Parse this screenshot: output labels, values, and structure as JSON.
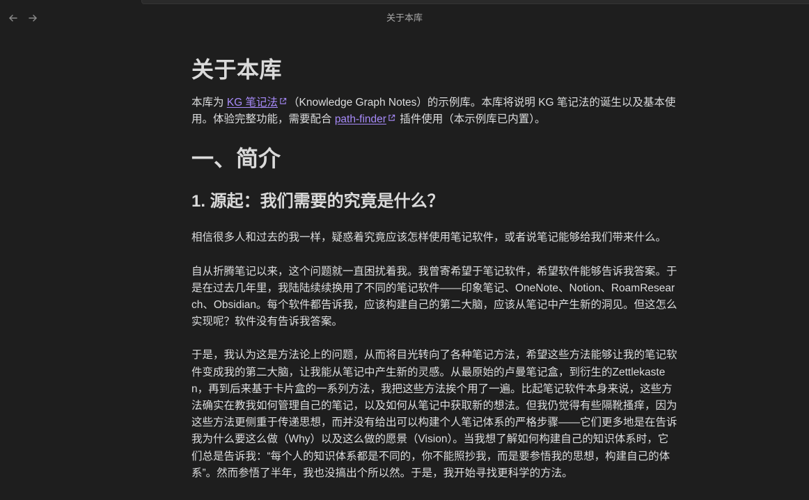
{
  "topbar": {
    "title": "关于本库",
    "back_icon": "arrow-left-icon",
    "forward_icon": "arrow-right-icon"
  },
  "document": {
    "title": "关于本库",
    "intro": {
      "before_link1": "本库为 ",
      "link1_text": "KG 笔记法",
      "between": "（Knowledge Graph Notes）的示例库。本库将说明 KG 笔记法的诞生以及基本使用。体验完整功能，需要配合 ",
      "link2_text": "path-finder",
      "after_link2": " 插件使用（本示例库已内置）。"
    },
    "h2_intro": "一、简介",
    "h3_origin": "1. 源起：我们需要的究竟是什么？",
    "para1": "相信很多人和过去的我一样，疑惑着究竟应该怎样使用笔记软件，或者说笔记能够给我们带来什么。",
    "para2": "自从折腾笔记以来，这个问题就一直困扰着我。我曾寄希望于笔记软件，希望软件能够告诉我答案。于是在过去几年里，我陆陆续续换用了不同的笔记软件——印象笔记、OneNote、Notion、RoamResearch、Obsidian。每个软件都告诉我，应该构建自己的第二大脑，应该从笔记中产生新的洞见。但这怎么实现呢？软件没有告诉我答案。",
    "para3": "于是，我认为这是方法论上的问题，从而将目光转向了各种笔记方法，希望这些方法能够让我的笔记软件变成我的第二大脑，让我能从笔记中产生新的灵感。从最原始的卢曼笔记盒，到衍生的Zettlekasten，再到后来基于卡片盒的一系列方法，我把这些方法挨个用了一遍。比起笔记软件本身来说，这些方法确实在教我如何管理自己的笔记，以及如何从笔记中获取新的想法。但我仍觉得有些隔靴搔痒，因为这些方法更侧重于传递思想，而并没有给出可以构建个人笔记体系的严格步骤——它们更多地是在告诉我为什么要这么做（Why）以及这么做的愿景（Vision）。当我想了解如何构建自己的知识体系时，它们总是告诉我：“每个人的知识体系都是不同的，你不能照抄我，而是要参悟我的思想，构建自己的体系”。然而参悟了半年，我也没搞出个所以然。于是，我开始寻找更科学的方法。"
  },
  "colors": {
    "background": "#1e1e1e",
    "text": "#dcddde",
    "link": "#a88bfa"
  }
}
